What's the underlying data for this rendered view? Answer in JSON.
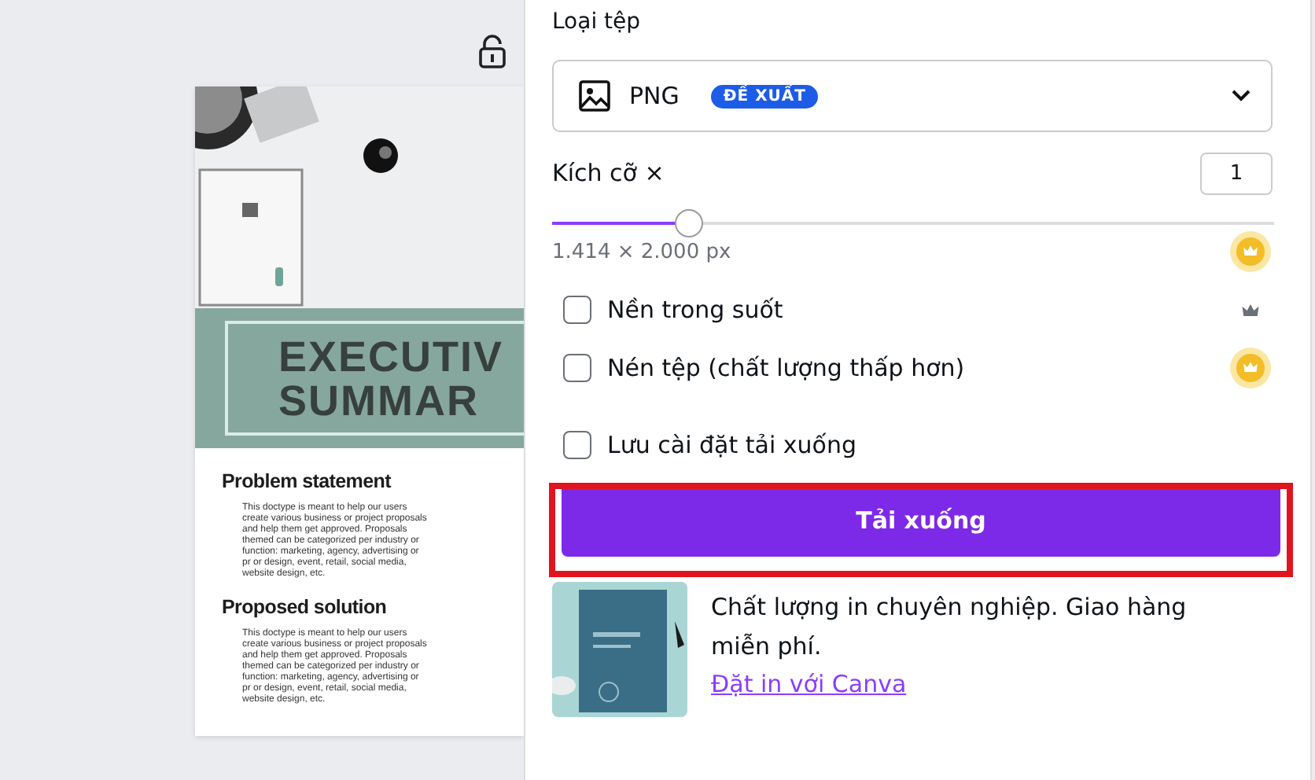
{
  "canvas": {
    "document": {
      "title_lines": [
        "EXECUTIV",
        "SUMMAR"
      ],
      "sections": [
        {
          "heading": "Problem statement",
          "body": "This doctype is meant to help our users create various business or project proposals and help them get approved. Proposals themed can be categorized per industry or function: marketing, agency, advertising or pr or design, event, retail, social media, website design, etc."
        },
        {
          "heading": "Proposed solution",
          "body": "This doctype is meant to help our users create various business or project proposals and help them get approved. Proposals themed can be categorized per industry or function: marketing, agency, advertising or pr or design, event, retail, social media, website design, etc."
        }
      ]
    }
  },
  "panel": {
    "file_type_label": "Loại tệp",
    "file_type": {
      "value": "PNG",
      "badge": "ĐỀ XUẤT"
    },
    "size": {
      "label": "Kích cỡ ×",
      "value": "1",
      "level": 0.19,
      "dimensions": "1.414 × 2.000 px",
      "premium": true,
      "premium_highlighted": true
    },
    "options": [
      {
        "label": "Nền trong suốt",
        "checked": false,
        "premium": true,
        "premium_highlighted": false
      },
      {
        "label": "Nén tệp (chất lượng thấp hơn)",
        "checked": false,
        "premium": true,
        "premium_highlighted": true
      },
      {
        "label": "Lưu cài đặt tải xuống",
        "checked": false,
        "premium": false
      }
    ],
    "download_button": {
      "label": "Tải xuống",
      "highlighted": true
    },
    "print_promo": {
      "text": "Chất lượng in chuyên nghiệp. Giao hàng miễn phí.",
      "link": "Đặt in với Canva"
    }
  }
}
